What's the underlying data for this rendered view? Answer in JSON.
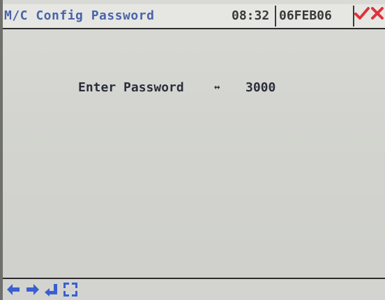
{
  "header": {
    "title": "M/C Config Password",
    "time": "08:32",
    "date": "06FEB06",
    "colors": {
      "title": "#4a64a8",
      "confirm": "#e0313a",
      "cancel": "#e0313a"
    }
  },
  "main": {
    "prompt_label": "Enter Password",
    "prompt_arrow": "↔",
    "password_value": "3000"
  },
  "footer": {
    "icons": [
      "arrow-left-icon",
      "arrow-right-icon",
      "enter-icon",
      "full-screen-icon"
    ],
    "icon_color": "#3b5fd0"
  }
}
